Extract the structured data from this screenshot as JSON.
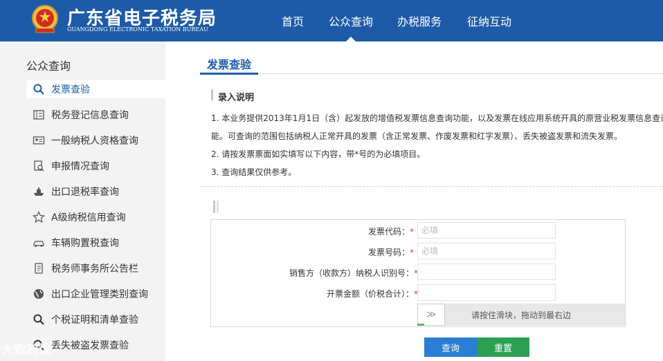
{
  "header": {
    "title_cn": "广东省电子税务局",
    "title_en": "GUANGDONG ELECTRONIC TAXATION BUREAU",
    "nav": [
      {
        "label": "首页"
      },
      {
        "label": "公众查询",
        "active": true
      },
      {
        "label": "办税服务"
      },
      {
        "label": "征纳互动"
      }
    ]
  },
  "sidebar": {
    "title": "公众查询",
    "items": [
      {
        "label": "发票查验",
        "icon": "search-icon",
        "active": true
      },
      {
        "label": "税务登记信息查询",
        "icon": "registration-icon"
      },
      {
        "label": "一般纳税人资格查询",
        "icon": "id-card-icon"
      },
      {
        "label": "申报情况查询",
        "icon": "document-search-icon"
      },
      {
        "label": "出口退税率查询",
        "icon": "ship-icon"
      },
      {
        "label": "A级纳税信用查询",
        "icon": "star-icon"
      },
      {
        "label": "车辆购置税查询",
        "icon": "car-icon"
      },
      {
        "label": "税务师事务所公告栏",
        "icon": "notice-icon"
      },
      {
        "label": "出口企业管理类别查询",
        "icon": "globe-icon"
      },
      {
        "label": "个税证明和清单查验",
        "icon": "search-icon"
      },
      {
        "label": "丢失被盗发票查验",
        "icon": "search-icon"
      }
    ]
  },
  "main": {
    "page_title": "发票查验",
    "section_title": "录入说明",
    "notes": [
      "1. 本业务提供2013年1月1日（含）起发放的增值税发票信息查询功能，以及发票在线应用系统开具的原营业税发票信息查询功",
      "能。可查询的范围包括纳税人正常开具的发票（含正常发票、作废发票和红字发票）、丢失被盗发票和流失发票。",
      "2. 请按发票票面如实填写以下内容，带*号的为必填项目。",
      "3. 查询结果仅供参考。"
    ],
    "form": {
      "fields": [
        {
          "label": "发票代码：",
          "placeholder": "必填"
        },
        {
          "label": "发票号码：",
          "placeholder": "必填"
        },
        {
          "label": "销售方（收款方）纳税人识别号：",
          "placeholder": ""
        },
        {
          "label": "开票金额（价税合计）：",
          "placeholder": ""
        }
      ],
      "required_mark": "*",
      "slider_text": "请按住滑块，拖动到最右边",
      "slider_handle": "≫",
      "query_label": "查询",
      "reset_label": "重置"
    }
  },
  "watermark": "大数跨境",
  "colors": {
    "brand_blue": "#1d5ba8",
    "query_button": "#2a7ed3",
    "reset_button": "#2aa052",
    "required": "#ee3333"
  }
}
